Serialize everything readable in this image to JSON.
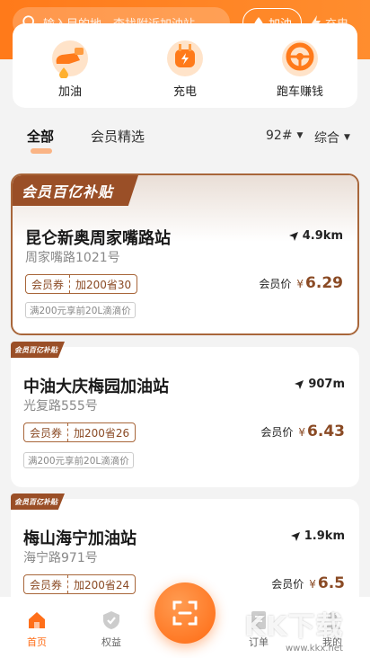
{
  "header": {
    "search_placeholder": "输入目的地，查找附近加油站",
    "fuel_label": "加油",
    "charge_label": "充电"
  },
  "services": [
    {
      "label": "加油",
      "icon": "fuel-nozzle-icon"
    },
    {
      "label": "充电",
      "icon": "charging-plug-icon"
    },
    {
      "label": "跑车赚钱",
      "icon": "steering-wheel-icon"
    }
  ],
  "tabs": {
    "all": "全部",
    "members": "会员精选",
    "fuel_type": "92#",
    "sort": "综合"
  },
  "badge_text": "会员百亿补贴",
  "stations": [
    {
      "name": "昆仑新奥周家嘴路站",
      "address": "周家嘴路1021号",
      "distance": "4.9km",
      "coupon_label": "会员券",
      "coupon_value": "加200省30",
      "price_label": "会员价",
      "currency": "¥",
      "price": "6.29",
      "note": "满200元享前20L滴滴价"
    },
    {
      "name": "中油大庆梅园加油站",
      "address": "光复路555号",
      "distance": "907m",
      "coupon_label": "会员券",
      "coupon_value": "加200省26",
      "price_label": "会员价",
      "currency": "¥",
      "price": "6.43",
      "note": "满200元享前20L滴滴价"
    },
    {
      "name": "梅山海宁加油站",
      "address": "海宁路971号",
      "distance": "1.9km",
      "coupon_label": "会员券",
      "coupon_value": "加200省24",
      "price_label": "会员价",
      "currency": "¥",
      "price": "6.5"
    }
  ],
  "nav": {
    "home": "首页",
    "benefits": "权益",
    "orders": "订单",
    "mine": "我的"
  },
  "watermark": {
    "text": "KK下载",
    "url": "www.kkx.net"
  },
  "colors": {
    "accent": "#ff7a1a",
    "member_brown": "#9a4f27"
  }
}
